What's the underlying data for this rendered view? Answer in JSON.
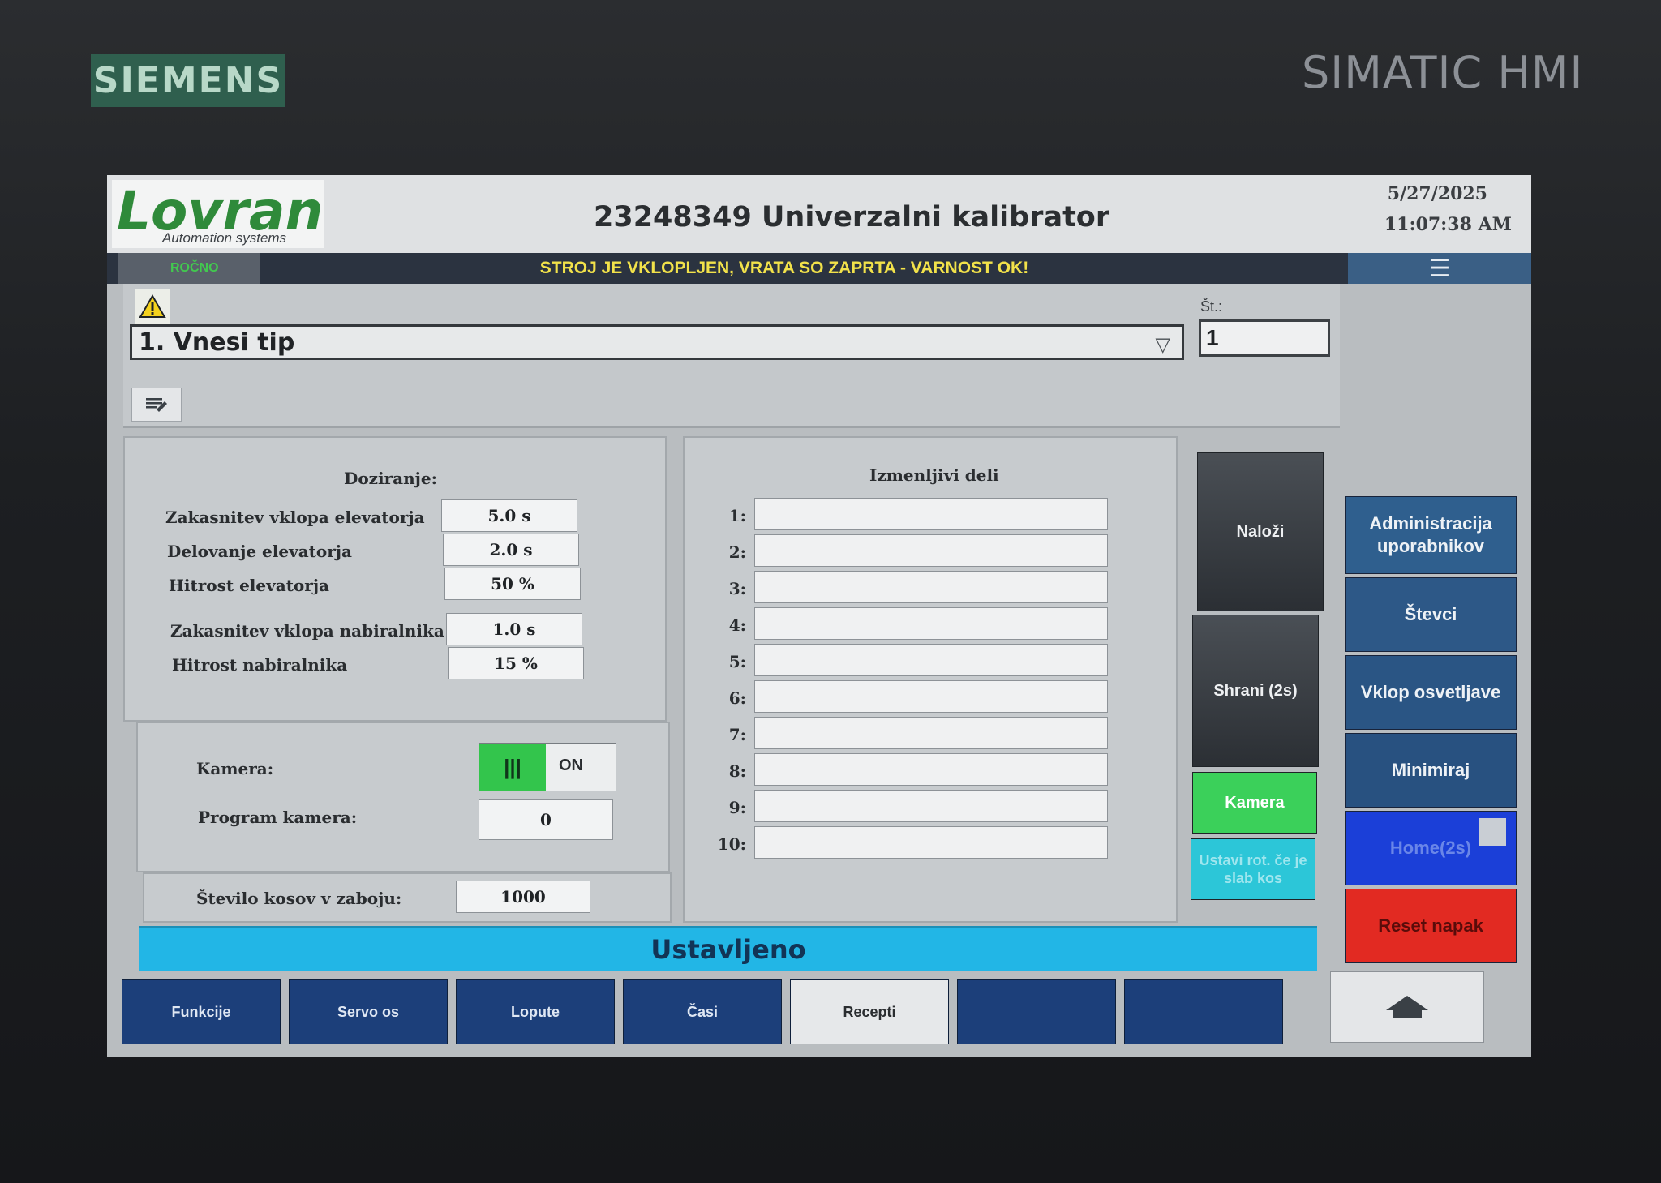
{
  "bezel": {
    "brand": "SIEMENS",
    "model": "SIMATIC HMI"
  },
  "header": {
    "logo_main": "Lovran",
    "logo_sub": "Automation systems",
    "title": "23248349 Univerzalni kalibrator",
    "date": "5/27/2025",
    "time": "11:07:38 AM"
  },
  "statusbar": {
    "mode": "ROČNO",
    "message": "STROJ JE VKLOPLJEN, VRATA SO ZAPRTA - VARNOST OK!",
    "menu_glyph": "☰"
  },
  "top": {
    "warning_count": "1",
    "type_value": "1. Vnesi tip",
    "st_label": "Št.:",
    "st_value": "1"
  },
  "doziranje": {
    "title": "Doziranje:",
    "rows": [
      {
        "label": "Zakasnitev vklopa elevatorja",
        "value": "5.0 s"
      },
      {
        "label": "Delovanje elevatorja",
        "value": "2.0 s"
      },
      {
        "label": "Hitrost elevatorja",
        "value": "50 %"
      },
      {
        "label": "Zakasnitev vklopa nabiralnika",
        "value": "1.0 s"
      },
      {
        "label": "Hitrost nabiralnika",
        "value": "15 %"
      }
    ]
  },
  "kamera": {
    "label": "Kamera:",
    "toggle_state": "ON",
    "program_label": "Program kamera:",
    "program_value": "0"
  },
  "kosov": {
    "label": "Število kosov v zaboju:",
    "value": "1000"
  },
  "deli": {
    "title": "Izmenljivi deli",
    "rows": [
      "1:",
      "2:",
      "3:",
      "4:",
      "5:",
      "6:",
      "7:",
      "8:",
      "9:",
      "10:"
    ]
  },
  "actions": {
    "nalozi": "Naloži",
    "shrani": "Shrani (2s)",
    "kamera": "Kamera",
    "ustavi": "Ustavi rot. če je slab kos"
  },
  "side": {
    "admin": "Administracija uporabnikov",
    "stevci": "Števci",
    "vklop": "Vklop osvetljave",
    "minimiraj": "Minimiraj",
    "home": "Home(2s)",
    "reset": "Reset napak"
  },
  "state": "Ustavljeno",
  "nav": [
    "Funkcije",
    "Servo os",
    "Lopute",
    "Časi",
    "Recepti",
    "",
    ""
  ],
  "nav_active_index": 4,
  "colors": {
    "accent_green": "#33c54c",
    "status_blue": "#22b6e6",
    "reset_red": "#e22a22",
    "nav_blue": "#1c3f7a"
  }
}
